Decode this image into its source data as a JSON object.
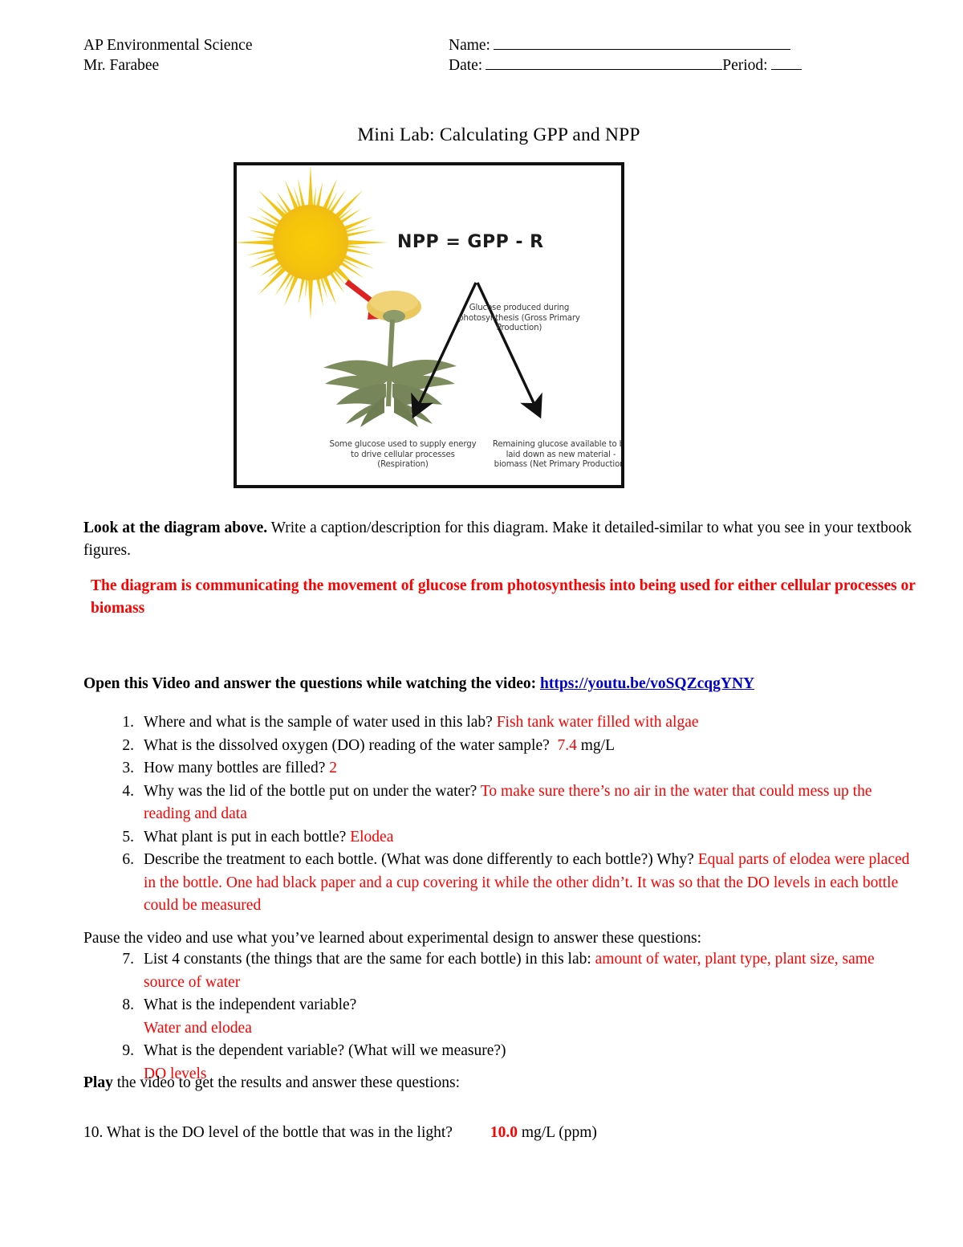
{
  "header": {
    "course": "AP Environmental Science",
    "teacher": "Mr. Farabee",
    "name_label": "Name:",
    "date_label": "Date:",
    "period_label": "Period:"
  },
  "title": "Mini Lab: Calculating GPP and NPP",
  "figure": {
    "formula": "NPP = GPP - R",
    "label_gpp": "Glucose produced during photosynthesis (Gross Primary Production)",
    "label_respiration": "Some glucose used to supply energy to drive cellular processes (Respiration)",
    "label_npp": "Remaining glucose available to be laid down as new material - biomass (Net Primary Production)",
    "colors": {
      "sun": "#F5C211",
      "sun_core": "#F7C800",
      "sun_ray": "#F0C419",
      "arrow_red": "#DD2222",
      "flower": "#EBC85E",
      "leaf": "#7D8C5C",
      "stem": "#7D8C5C",
      "arrow_black": "#111111",
      "border": "#111111"
    }
  },
  "prompt1": {
    "bold_lead": "Look at the diagram above.",
    "rest": " Write a caption/description for this diagram. Make it detailed-similar to what you see in your textbook figures."
  },
  "answer1": "The diagram is communicating the movement of glucose from photosynthesis into being used for either cellular processes or biomass",
  "video": {
    "lead": "Open this Video and answer the questions while watching the video:",
    "url": "https://youtu.be/voSQZcqgYNY"
  },
  "questions_a": [
    {
      "num": "1.",
      "question": "Where and what is the sample of water used in this lab?",
      "answer": "Fish tank water filled with algae",
      "answer_tail": ""
    },
    {
      "num": "2.",
      "question": "What is the dissolved oxygen (DO) reading of the water sample?",
      "answer": "7.4",
      "answer_tail": "mg/L"
    },
    {
      "num": "3.",
      "question": "How many bottles are filled?",
      "answer": "2",
      "answer_tail": ""
    },
    {
      "num": "4.",
      "question": "Why was the lid of the bottle put on under the water?",
      "answer": "To make sure there’s no air in the water that could mess up the reading and data",
      "answer_tail": ""
    },
    {
      "num": "5.",
      "question": "What plant is put in each bottle?",
      "answer": "Elodea",
      "answer_tail": ""
    },
    {
      "num": "6.",
      "question": "Describe the treatment to each bottle. (What was done differently to each bottle?) Why?",
      "answer": "Equal parts of elodea were placed in the bottle. One had black paper and a cup covering it while the other didn’t. It was so that the DO levels in each bottle could be measured",
      "answer_tail": ""
    }
  ],
  "pause_line": "Pause the video and use what you’ve learned about experimental design to answer these questions:",
  "questions_b": [
    {
      "num": "7.",
      "question": "List 4 constants (the things that are the same for each bottle) in this lab:",
      "answer": "amount of water, plant type, plant size, same source of water",
      "newline_answer": false
    },
    {
      "num": "8.",
      "question": "What is the independent variable?",
      "answer": "Water and elodea",
      "newline_answer": true
    },
    {
      "num": "9.",
      "question": "What is the dependent variable? (What will we measure?)",
      "answer": "DO levels",
      "newline_answer": true
    }
  ],
  "play_line": {
    "bold_lead": "Play",
    "rest": " the video to get the results and answer these questions:"
  },
  "question10": {
    "num": "10.",
    "question": "What is the DO level of the bottle that was in the light?",
    "answer": "10.0",
    "answer_tail": "mg/L (ppm)"
  }
}
